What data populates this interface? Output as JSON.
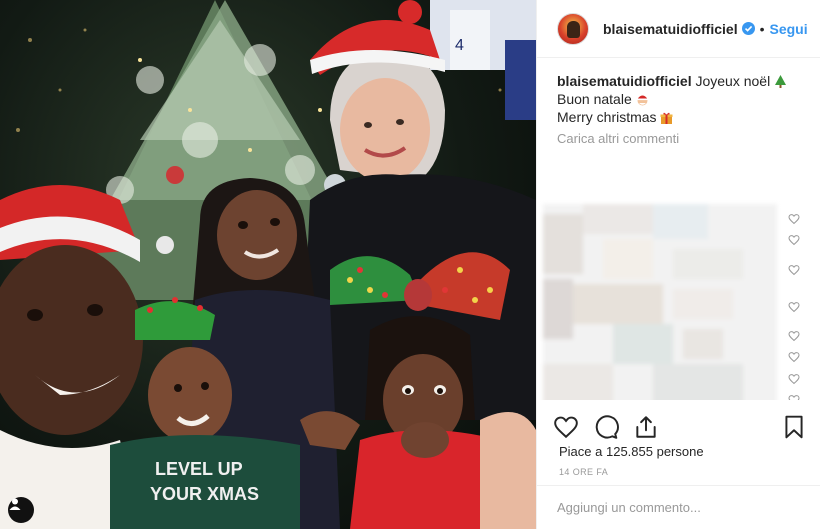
{
  "post": {
    "username": "blaisematuidiofficiel",
    "follow_label": "Segui",
    "dot_separator": "•",
    "caption_line1": "Joyeux noël",
    "caption_line2": "Buon natale",
    "caption_line3": "Merry christmas",
    "load_more": "Carica altri commenti",
    "likes_prefix": "Piace a ",
    "likes_count": "125.855",
    "likes_suffix": " persone",
    "timestamp": "14 ore fa",
    "comment_placeholder": "Aggiungi un commento...",
    "photo_sweater_text_1": "LEVEL UP",
    "photo_sweater_text_2": "YOUR XMAS"
  },
  "icons": {
    "verified": "verified-badge-icon",
    "like": "heart-icon",
    "comment": "comment-icon",
    "share": "share-icon",
    "save": "bookmark-icon",
    "tree_emoji": "christmas-tree-emoji",
    "santa_emoji": "santa-emoji",
    "gift_emoji": "gift-emoji"
  },
  "colors": {
    "link_blue": "#3897f0",
    "text": "#262626",
    "muted": "#999999",
    "border": "#efefef"
  }
}
